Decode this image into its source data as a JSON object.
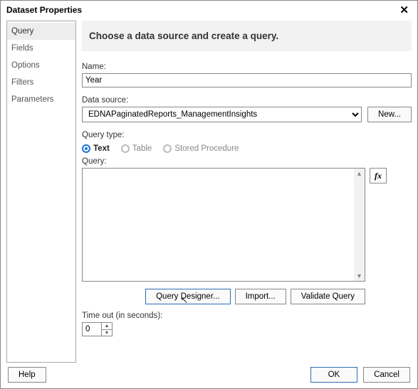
{
  "window": {
    "title": "Dataset Properties"
  },
  "sidebar": {
    "items": [
      {
        "label": "Query"
      },
      {
        "label": "Fields"
      },
      {
        "label": "Options"
      },
      {
        "label": "Filters"
      },
      {
        "label": "Parameters"
      }
    ]
  },
  "main": {
    "heading": "Choose a data source and create a query.",
    "name_label": "Name:",
    "name_value": "Year",
    "datasource_label": "Data source:",
    "datasource_value": "EDNAPaginatedReports_ManagementInsights",
    "new_button": "New...",
    "querytype_label": "Query type:",
    "querytype_options": {
      "text": "Text",
      "table": "Table",
      "sproc": "Stored Procedure"
    },
    "query_label": "Query:",
    "query_text": "",
    "fx_label": "fx",
    "query_designer": "Query Designer...",
    "import_btn": "Import...",
    "validate_btn": "Validate Query",
    "timeout_label": "Time out (in seconds):",
    "timeout_value": "0"
  },
  "footer": {
    "help": "Help",
    "ok": "OK",
    "cancel": "Cancel"
  }
}
